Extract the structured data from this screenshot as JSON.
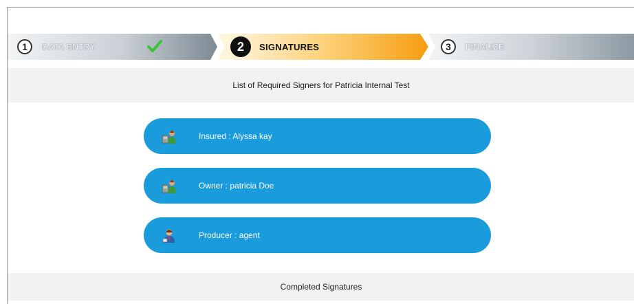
{
  "stepper": {
    "steps": [
      {
        "number": "1",
        "label": "DATA ENTRY",
        "state": "complete"
      },
      {
        "number": "2",
        "label": "SIGNATURES",
        "state": "active"
      },
      {
        "number": "3",
        "label": "FINALIZE",
        "state": "pending"
      }
    ],
    "colors": {
      "active": "#f5a21a",
      "inactive": "#8e9aa4",
      "check": "#3cc23c"
    }
  },
  "required_section": {
    "title": "List of Required Signers for Patricia Internal Test",
    "signers": [
      {
        "label": "Insured : Alyssa kay",
        "icon": "insured-person-icon"
      },
      {
        "label": "Owner : patricia Doe",
        "icon": "owner-person-icon"
      },
      {
        "label": "Producer : agent",
        "icon": "agent-person-icon"
      }
    ],
    "pill_color": "#1a9bdb"
  },
  "completed_section": {
    "title": "Completed Signatures"
  }
}
